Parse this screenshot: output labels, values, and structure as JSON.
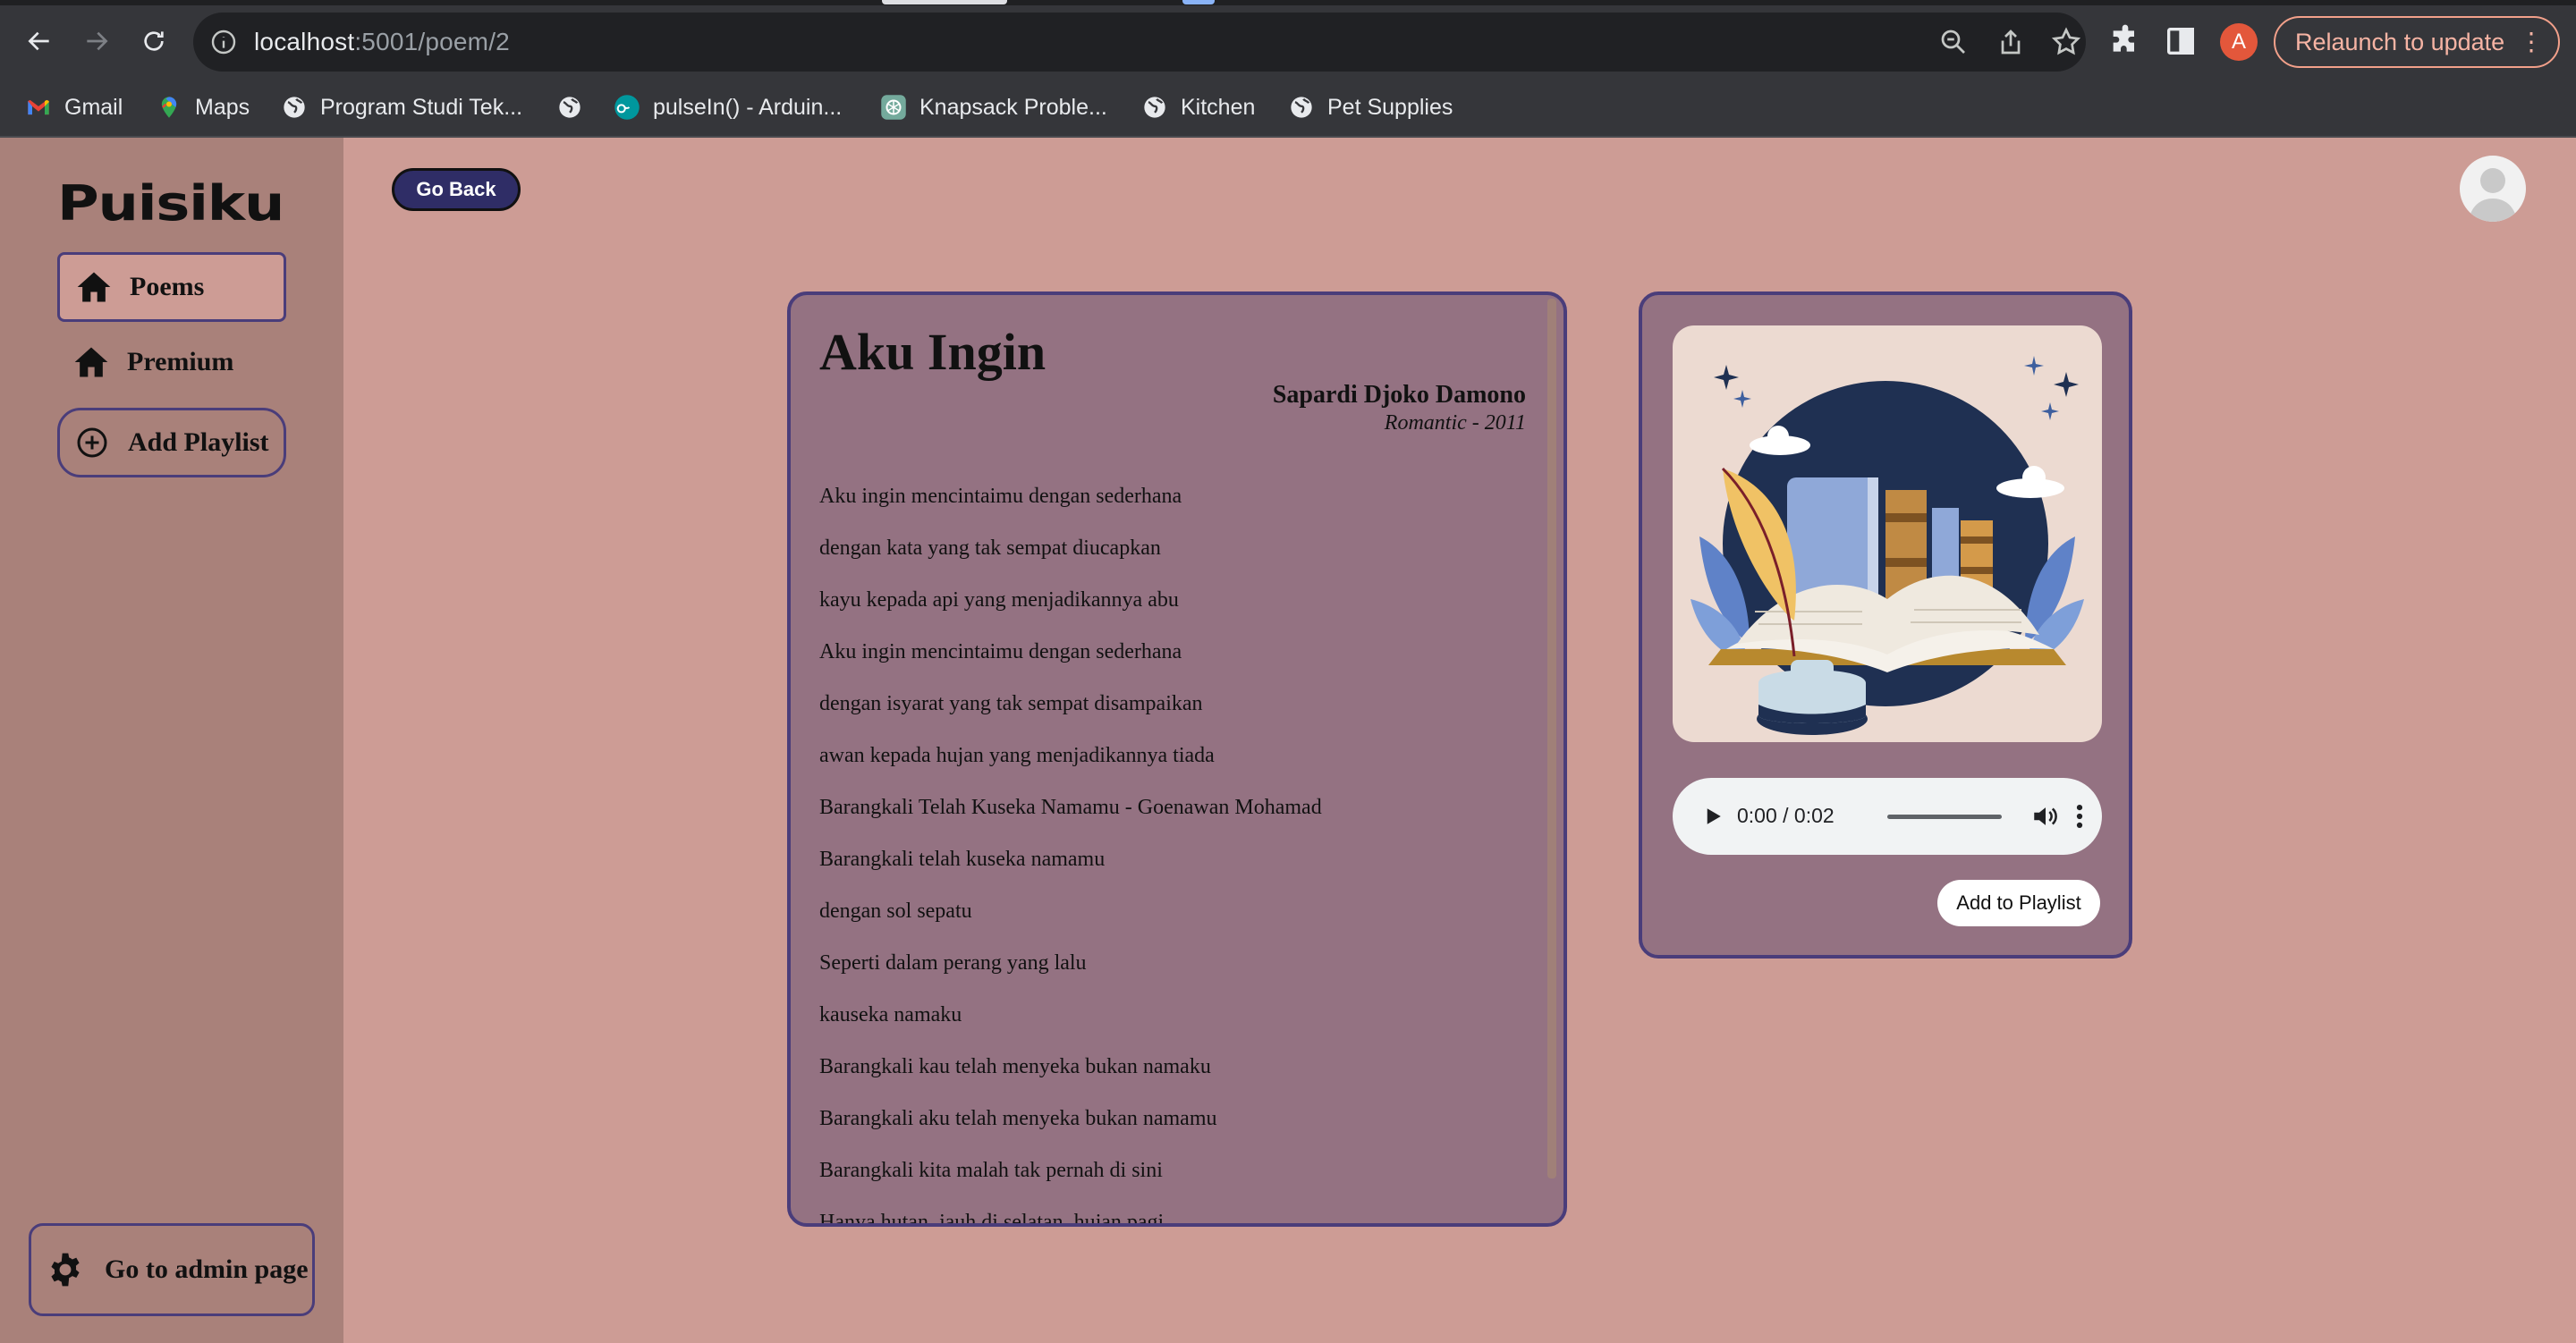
{
  "browser": {
    "url_host": "localhost",
    "url_path": ":5001/poem/2",
    "profile_initial": "A",
    "relaunch_label": "Relaunch to update",
    "bookmarks": [
      {
        "label": "Gmail",
        "icon": "gmail-icon"
      },
      {
        "label": "Maps",
        "icon": "maps-icon"
      },
      {
        "label": "Program Studi Tek...",
        "icon": "globe-icon"
      },
      {
        "label": "",
        "icon": "globe-icon"
      },
      {
        "label": "pulseIn() - Arduin...",
        "icon": "arduino-icon"
      },
      {
        "label": "Knapsack Proble...",
        "icon": "chatgpt-icon"
      },
      {
        "label": "Kitchen",
        "icon": "globe-icon"
      },
      {
        "label": "Pet Supplies",
        "icon": "globe-icon"
      }
    ]
  },
  "sidebar": {
    "logo": "Puisiku",
    "items": [
      {
        "label": "Poems",
        "icon": "home-icon",
        "active": true
      },
      {
        "label": "Premium",
        "icon": "home-icon",
        "active": false
      }
    ],
    "add_playlist": "Add Playlist",
    "admin": "Go to admin page"
  },
  "header": {
    "go_back": "Go Back"
  },
  "poem": {
    "title": "Aku Ingin",
    "author": "Sapardi Djoko Damono",
    "meta": "Romantic - 2011",
    "lines": [
      "Aku ingin mencintaimu dengan sederhana",
      "dengan kata yang tak sempat diucapkan",
      "kayu kepada api yang menjadikannya abu",
      "Aku ingin mencintaimu dengan sederhana",
      "dengan isyarat yang tak sempat disampaikan",
      "awan kepada hujan yang menjadikannya tiada",
      "Barangkali Telah Kuseka Namamu - Goenawan Mohamad",
      "Barangkali telah kuseka namamu",
      "dengan sol sepatu",
      "Seperti dalam perang yang lalu",
      "kauseka namaku",
      "Barangkali kau telah menyeka bukan namaku",
      "Barangkali aku telah menyeka bukan namamu",
      "Barangkali kita malah tak pernah di sini",
      "Hanya hutan, jauh di selatan, hujan pagi"
    ]
  },
  "player": {
    "time": "0:00 / 0:02",
    "add_to_playlist": "Add to Playlist"
  },
  "colors": {
    "background": "#cd9c95",
    "sidebar": "#a9817a",
    "card": "#947282",
    "border": "#4a3d7a",
    "go_back_button": "#2f2d66"
  }
}
